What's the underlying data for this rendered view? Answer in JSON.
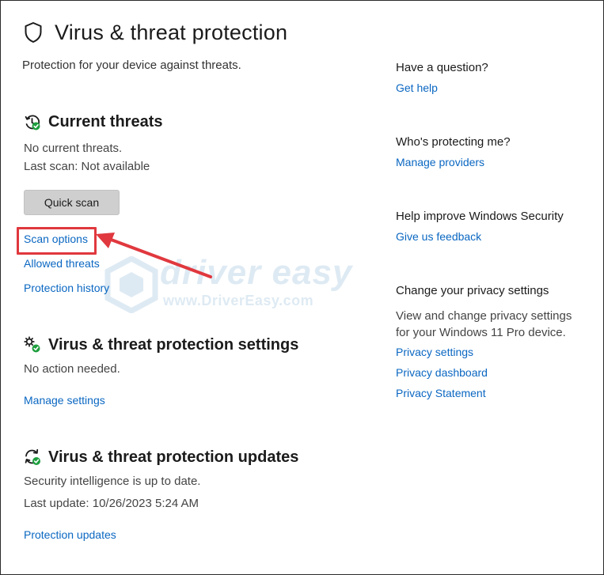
{
  "page": {
    "title": "Virus & threat protection",
    "subtitle": "Protection for your device against threats."
  },
  "current_threats": {
    "heading": "Current threats",
    "status": "No current threats.",
    "last_scan": "Last scan: Not available",
    "quick_scan_label": "Quick scan",
    "links": {
      "scan_options": "Scan options",
      "allowed_threats": "Allowed threats",
      "protection_history": "Protection history"
    }
  },
  "settings": {
    "heading": "Virus & threat protection settings",
    "status": "No action needed.",
    "manage_link": "Manage settings"
  },
  "updates": {
    "heading": "Virus & threat protection updates",
    "status": "Security intelligence is up to date.",
    "last_update": "Last update: 10/26/2023 5:24 AM",
    "link": "Protection updates"
  },
  "sidebar": {
    "question_heading": "Have a question?",
    "get_help": "Get help",
    "protecting_heading": "Who's protecting me?",
    "manage_providers": "Manage providers",
    "improve_heading": "Help improve Windows Security",
    "feedback": "Give us feedback",
    "privacy_heading": "Change your privacy settings",
    "privacy_text": "View and change privacy settings for your Windows 11 Pro device.",
    "privacy_settings": "Privacy settings",
    "privacy_dashboard": "Privacy dashboard",
    "privacy_statement": "Privacy Statement"
  },
  "watermark": {
    "brand": "driver easy",
    "url": "www.DriverEasy.com"
  },
  "colors": {
    "link": "#0a67c2",
    "annotation": "#e0383e",
    "status_ok": "#1e9e3e"
  },
  "icons": {
    "title": "shield-icon",
    "current_threats": "history-check-icon",
    "settings": "gears-check-icon",
    "updates": "refresh-check-icon"
  }
}
